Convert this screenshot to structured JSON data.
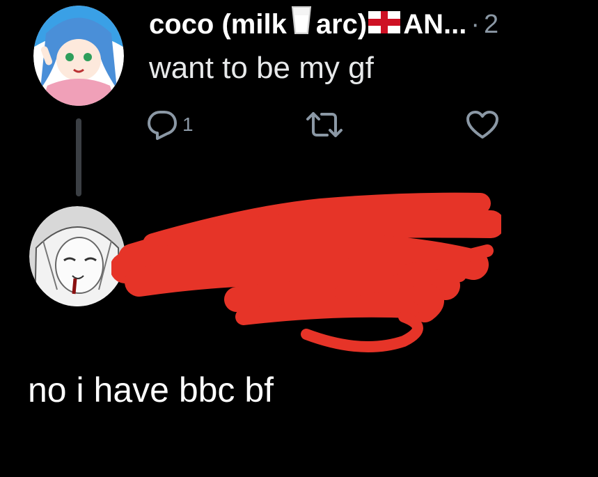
{
  "tweet": {
    "author_name_part1": "coco (milk",
    "author_name_part2": "arc)",
    "author_name_part3": "AN...",
    "separator": "·",
    "time": "2",
    "text": "want to be my gf",
    "reply_count": "1"
  },
  "reply": {
    "text": "no i have bbc bf"
  },
  "colors": {
    "background": "#000000",
    "text_primary": "#e7e9ea",
    "text_secondary": "#8b98a5",
    "redaction": "#e63428"
  },
  "icons": [
    "milk-glass-icon",
    "england-flag-icon",
    "reply-icon",
    "retweet-icon",
    "like-icon"
  ]
}
